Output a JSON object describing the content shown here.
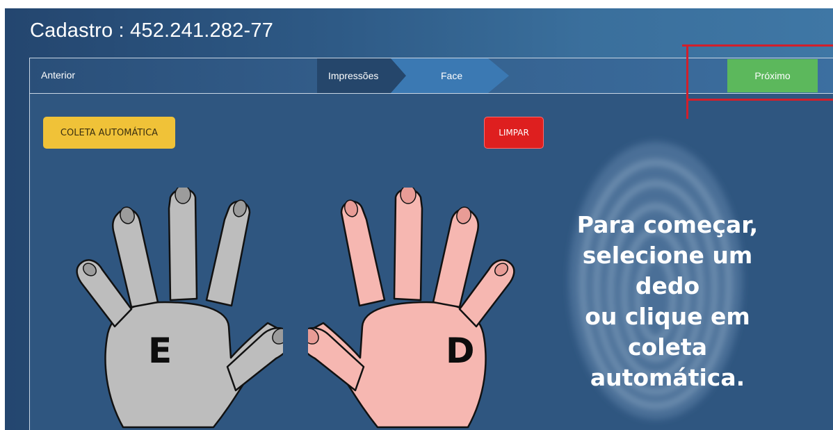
{
  "header": {
    "title": "Cadastro : 452.241.282-77"
  },
  "nav": {
    "prev_label": "Anterior",
    "steps": [
      {
        "label": "Impressões"
      },
      {
        "label": "Face"
      }
    ],
    "next_label": "Próximo"
  },
  "actions": {
    "auto_label": "COLETA AUTOMÁTICA",
    "clear_label": "LIMPAR"
  },
  "hands": {
    "left": {
      "letter": "E",
      "color": "#bdbdbd"
    },
    "right": {
      "letter": "D",
      "color": "#f6b7b1"
    }
  },
  "instructions": {
    "lines": [
      "Para começar,",
      "selecione um dedo",
      "ou clique em",
      "coleta automática."
    ]
  },
  "colors": {
    "next_button": "#5cb85c",
    "auto_button": "#f0c238",
    "clear_button": "#de1f1f",
    "highlight": "#d21f2b"
  }
}
